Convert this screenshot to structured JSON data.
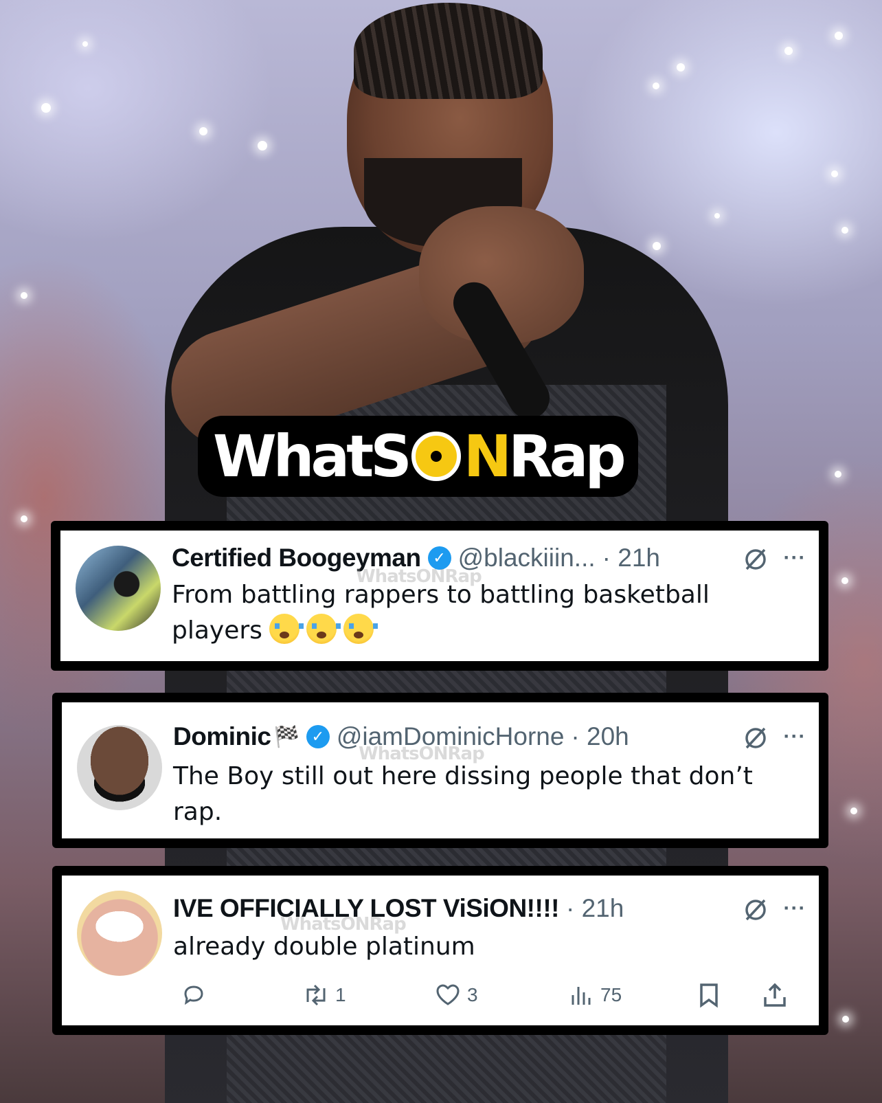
{
  "logo": {
    "part1": "WhatS",
    "part2": "N",
    "part3": "Rap"
  },
  "watermark": "WhatsONRap",
  "tweets": [
    {
      "name": "Certified Boogeyman",
      "handle": "@blackiiin...",
      "time": "· 21h",
      "text": "From battling rappers to battling basketball players",
      "emoji": "loudly-crying-face x3",
      "verified": true
    },
    {
      "name": "Dominic",
      "name_suffix_icon": "checkered-flag-icon",
      "handle": "@iamDominicHorne",
      "time": "· 20h",
      "text": "The Boy still out here dissing people that don’t rap.",
      "verified": true
    },
    {
      "name": "IVE OFFICIALLY LOST ViSiON!!!!",
      "time": "· 21h",
      "text": "already double platinum",
      "verified": false,
      "actions": {
        "reply": "",
        "retweets": "1",
        "likes": "3",
        "views": "75"
      }
    }
  ],
  "colors": {
    "accent_yellow": "#f6c812",
    "verified_blue": "#1d9bf0",
    "text_primary": "#0f1419",
    "text_secondary": "#536471"
  }
}
